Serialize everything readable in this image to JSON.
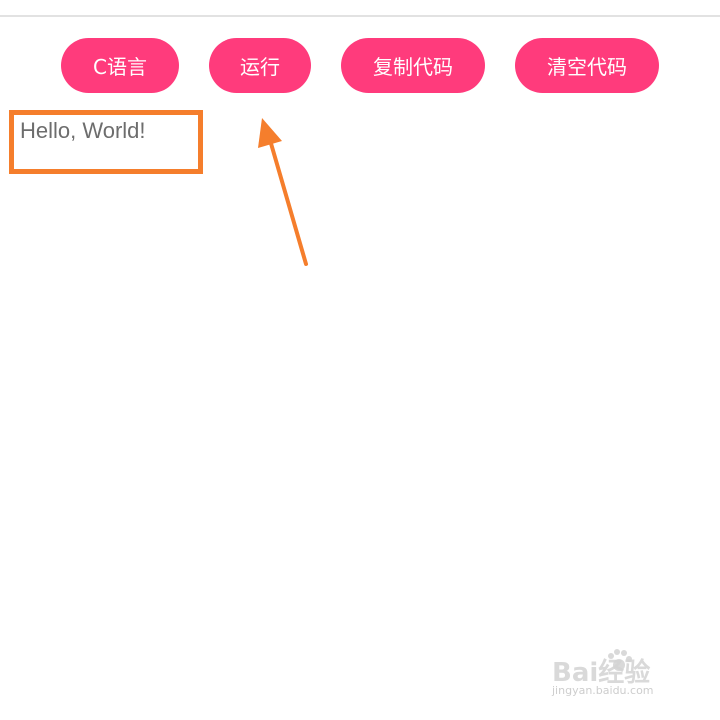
{
  "toolbar": {
    "lang_label": "C语言",
    "run_label": "运行",
    "copy_label": "复制代码",
    "clear_label": "清空代码"
  },
  "output": {
    "text": "Hello, World!"
  },
  "watermark": {
    "brand": "Bai经验",
    "url": "jingyan.baidu.com"
  },
  "colors": {
    "button_bg": "#ff3b7c",
    "annotation": "#f57e2c",
    "divider": "#e2e2e2"
  },
  "icons": {
    "annotation_arrow": "arrow-up-icon",
    "watermark_paw": "paw-icon"
  }
}
